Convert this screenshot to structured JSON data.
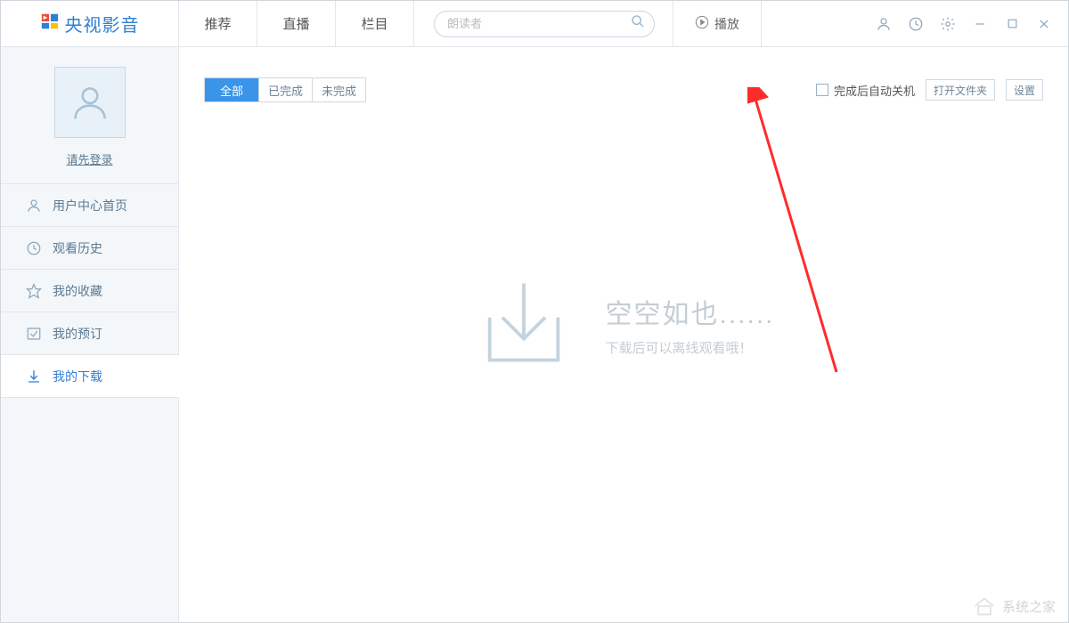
{
  "app_name": "央视影音",
  "header": {
    "tabs": [
      "推荐",
      "直播",
      "栏目"
    ],
    "search_placeholder": "朗读者",
    "play_label": "播放"
  },
  "sidebar": {
    "login_prompt": "请先登录",
    "items": [
      {
        "label": "用户中心首页"
      },
      {
        "label": "观看历史"
      },
      {
        "label": "我的收藏"
      },
      {
        "label": "我的预订"
      },
      {
        "label": "我的下载"
      }
    ]
  },
  "toolbar": {
    "filters": [
      "全部",
      "已完成",
      "未完成"
    ],
    "auto_shutdown_label": "完成后自动关机",
    "open_folder_label": "打开文件夹",
    "settings_label": "设置"
  },
  "empty_state": {
    "title": "空空如也......",
    "subtitle": "下载后可以离线观看哦！"
  },
  "watermark": "系统之家"
}
